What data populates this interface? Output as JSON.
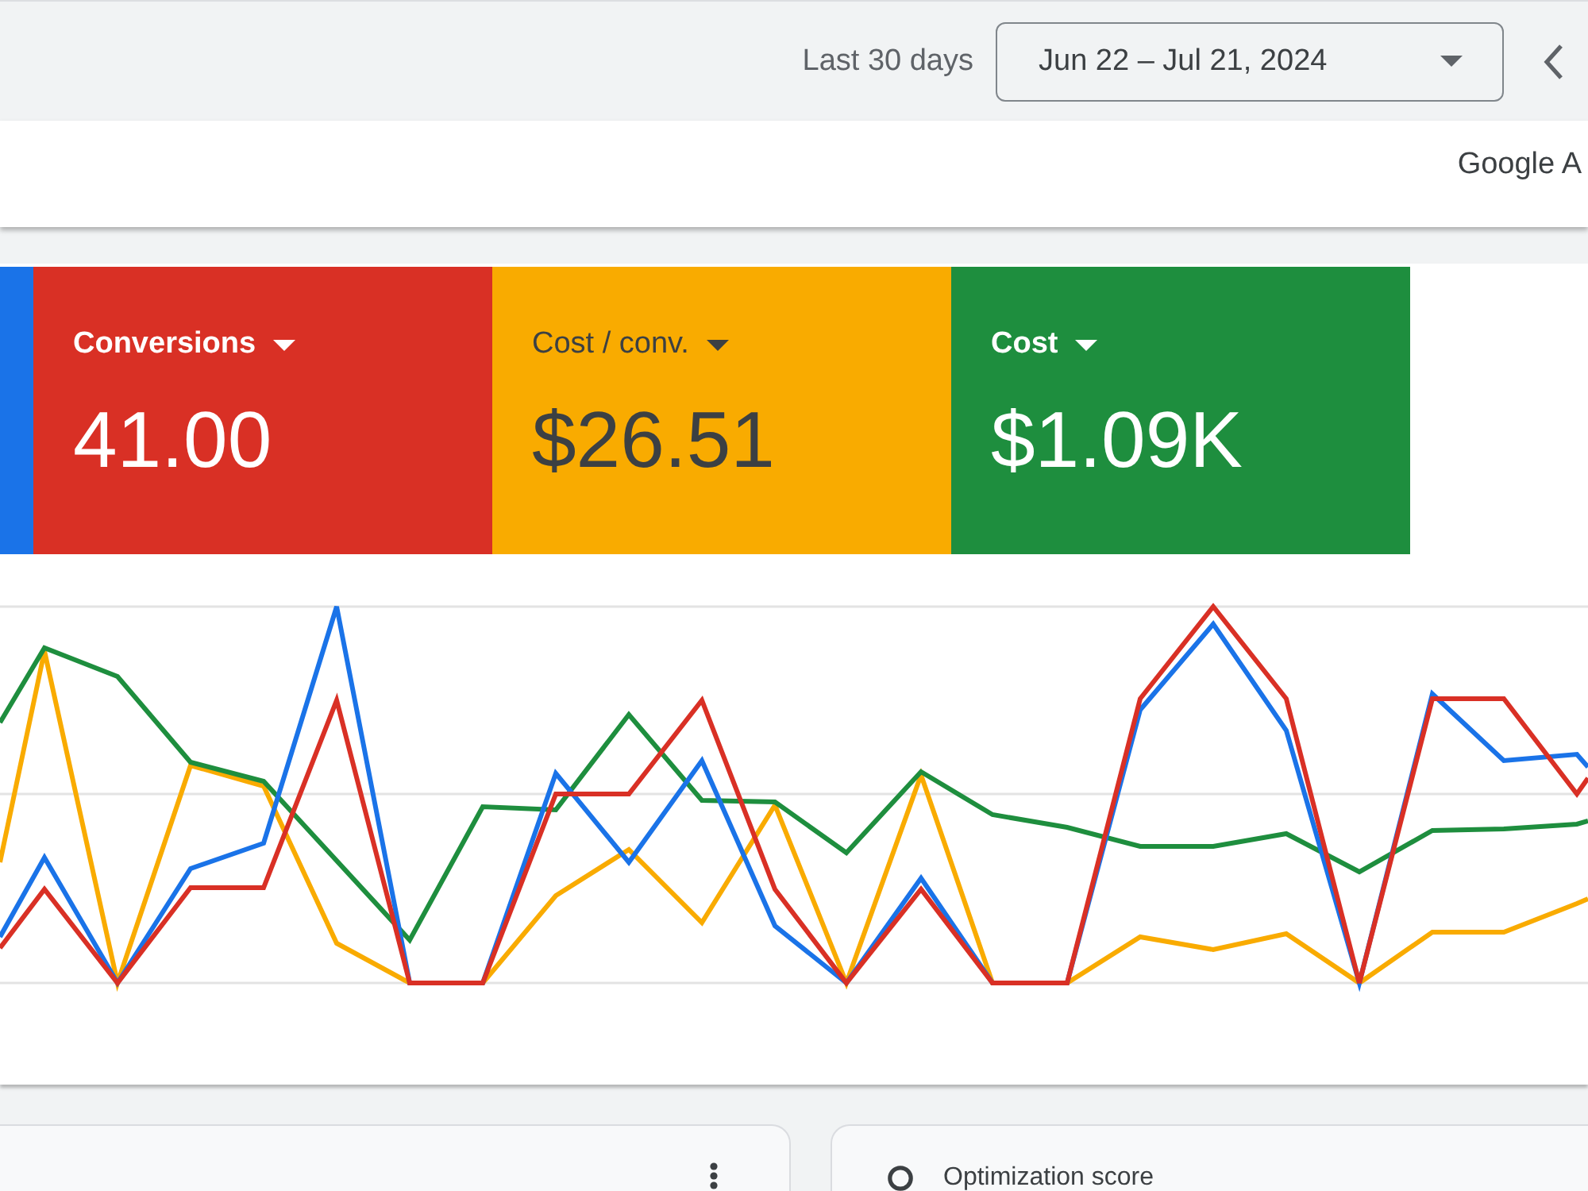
{
  "header": {
    "range_label": "Last 30 days",
    "date_range": "Jun 22 – Jul 21, 2024"
  },
  "toolbar": {
    "brand_text": "Google A"
  },
  "metric_tiles": [
    {
      "color": "#1a73e8"
    },
    {
      "label": "Conversions",
      "value": "41.00",
      "color": "#d93025"
    },
    {
      "label": "Cost / conv.",
      "value": "$26.51",
      "color": "#f9ab00"
    },
    {
      "label": "Cost",
      "value": "$1.09K",
      "color": "#1e8e3e"
    }
  ],
  "cards": [
    {
      "kind": "menu_card"
    },
    {
      "kind": "title_card",
      "title": "Optimization score"
    }
  ]
}
